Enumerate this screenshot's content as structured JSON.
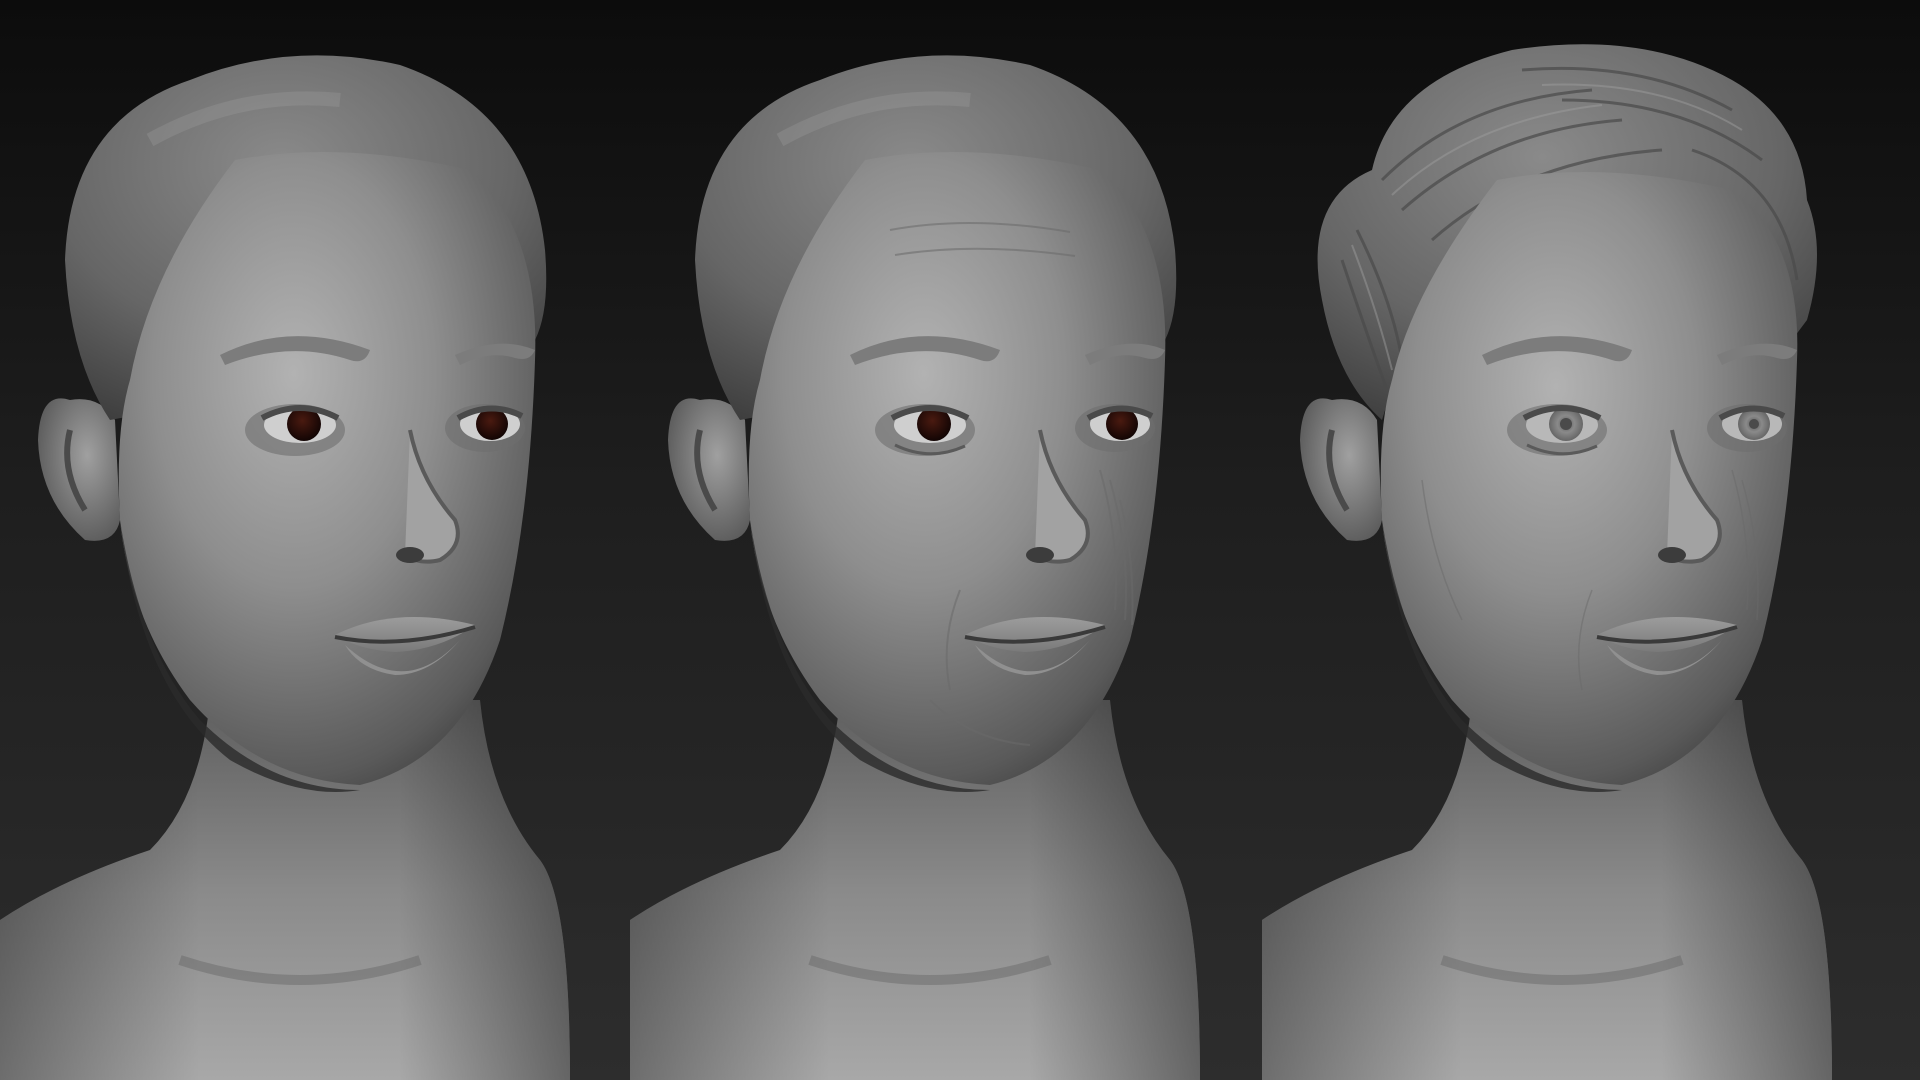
{
  "scene": {
    "background_color": "#1a1a1a",
    "clay_color": "#8c8c8c",
    "eye_color": "#2a0d08"
  },
  "renders": [
    {
      "hair": "smooth-cap",
      "eyes": "dark-spheres",
      "skin_detail": "smooth"
    },
    {
      "hair": "smooth-cap",
      "eyes": "dark-spheres",
      "skin_detail": "wrinkles"
    },
    {
      "hair": "sculpted-strands",
      "eyes": "sculpted-iris",
      "skin_detail": "pores"
    }
  ]
}
